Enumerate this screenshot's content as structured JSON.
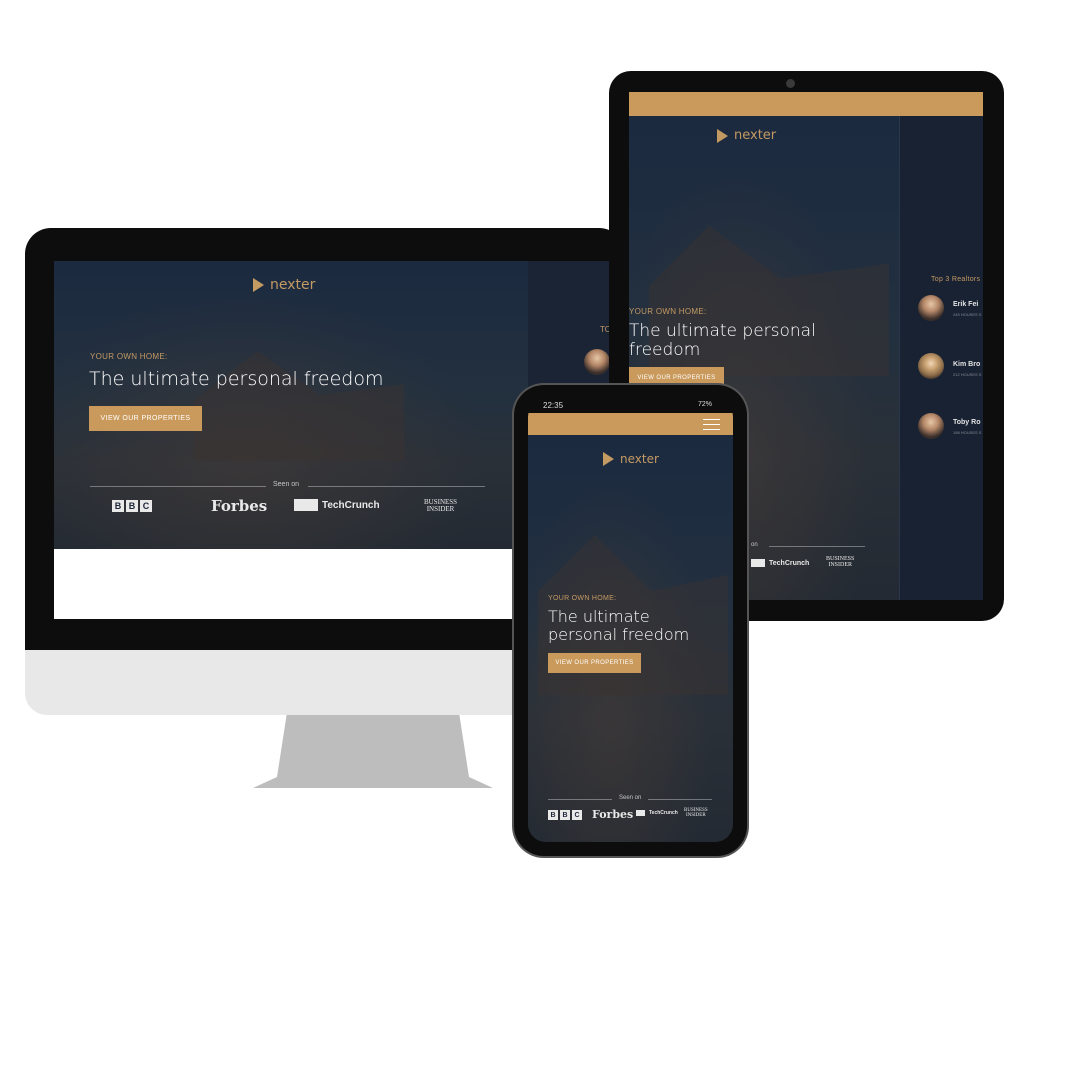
{
  "brand": {
    "logo_text": "nexter"
  },
  "hero": {
    "eyebrow": "Your own home:",
    "headline": "The ultimate personal freedom",
    "headline_mobile_line1": "The ultimate",
    "headline_mobile_line2": "personal freedom",
    "tablet_line1": "The ultimate personal",
    "tablet_line2": "freedom",
    "cta_label": "View our properties"
  },
  "seen_on": {
    "label": "Seen on",
    "label_partial": "on",
    "bbc_letters": [
      "B",
      "B",
      "C"
    ],
    "forbes": "Forbes",
    "techcrunch": "TechCrunch",
    "business_insider_line1": "Business",
    "business_insider_line2": "Insider"
  },
  "sidebar": {
    "title": "Top 3 Realtors",
    "title_desktop_partial": "TO",
    "realtors": [
      {
        "name": "Erik Fei",
        "sub": "245 HOUSES S"
      },
      {
        "name": "Kim Bro",
        "sub": "212 HOUSES S"
      },
      {
        "name": "Toby Ro",
        "sub": "198 HOUSES S"
      }
    ]
  },
  "phone_status": {
    "time": "22:35",
    "battery": "72%"
  },
  "colors": {
    "navy": "#1b2638",
    "gold": "#c99a5c",
    "bezel": "#0d0d0d",
    "stand": "#bdbdbd",
    "chin": "#e8e8e8"
  }
}
